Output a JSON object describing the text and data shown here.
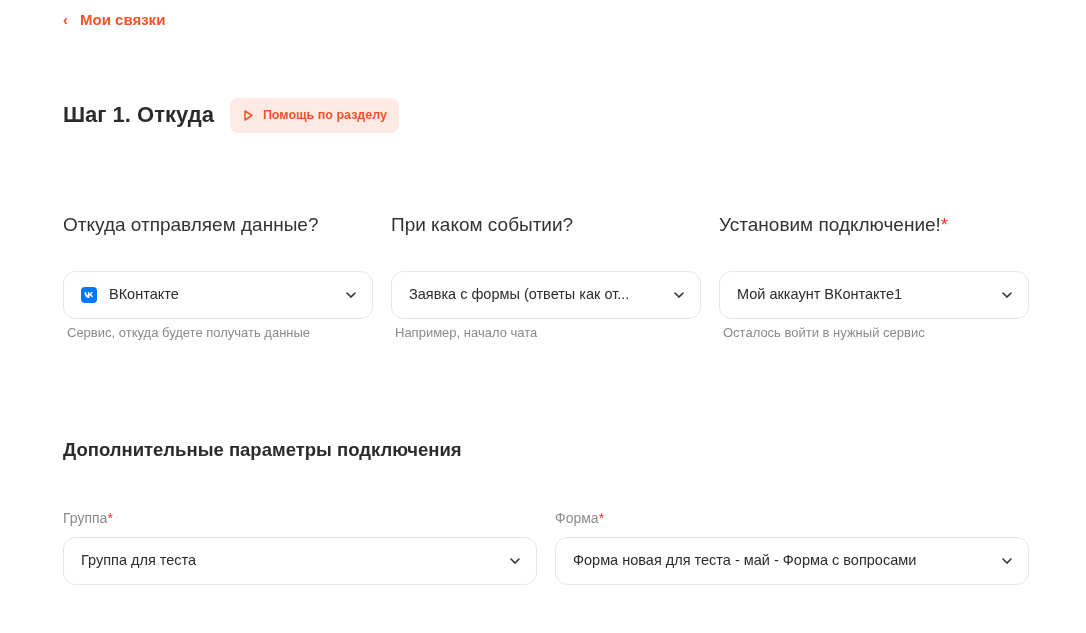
{
  "back_link": {
    "icon": "‹",
    "label": "Мои связки"
  },
  "step": {
    "title": "Шаг 1. Откуда",
    "help_button": "Помощь по разделу"
  },
  "columns": [
    {
      "question": "Откуда отправляем данные?",
      "select": {
        "kind": "service",
        "value": "ВКонтакте"
      },
      "hint": "Сервис, откуда будете получать данные"
    },
    {
      "question": "При каком событии?",
      "select": {
        "kind": "plain",
        "value": "Заявка с формы (ответы как от..."
      },
      "hint": "Например, начало чата"
    },
    {
      "question": "Установим подключение!",
      "required_mark": "*",
      "select": {
        "kind": "plain",
        "value": "Мой аккаунт ВКонтакте1"
      },
      "hint": "Осталось войти в нужный сервис"
    }
  ],
  "extra": {
    "title": "Дополнительные параметры подключения",
    "fields": [
      {
        "label": "Группа",
        "required_mark": "*",
        "value": "Группа для теста"
      },
      {
        "label": "Форма",
        "required_mark": "*",
        "value": "Форма новая для теста - май - Форма с вопросами"
      }
    ]
  }
}
